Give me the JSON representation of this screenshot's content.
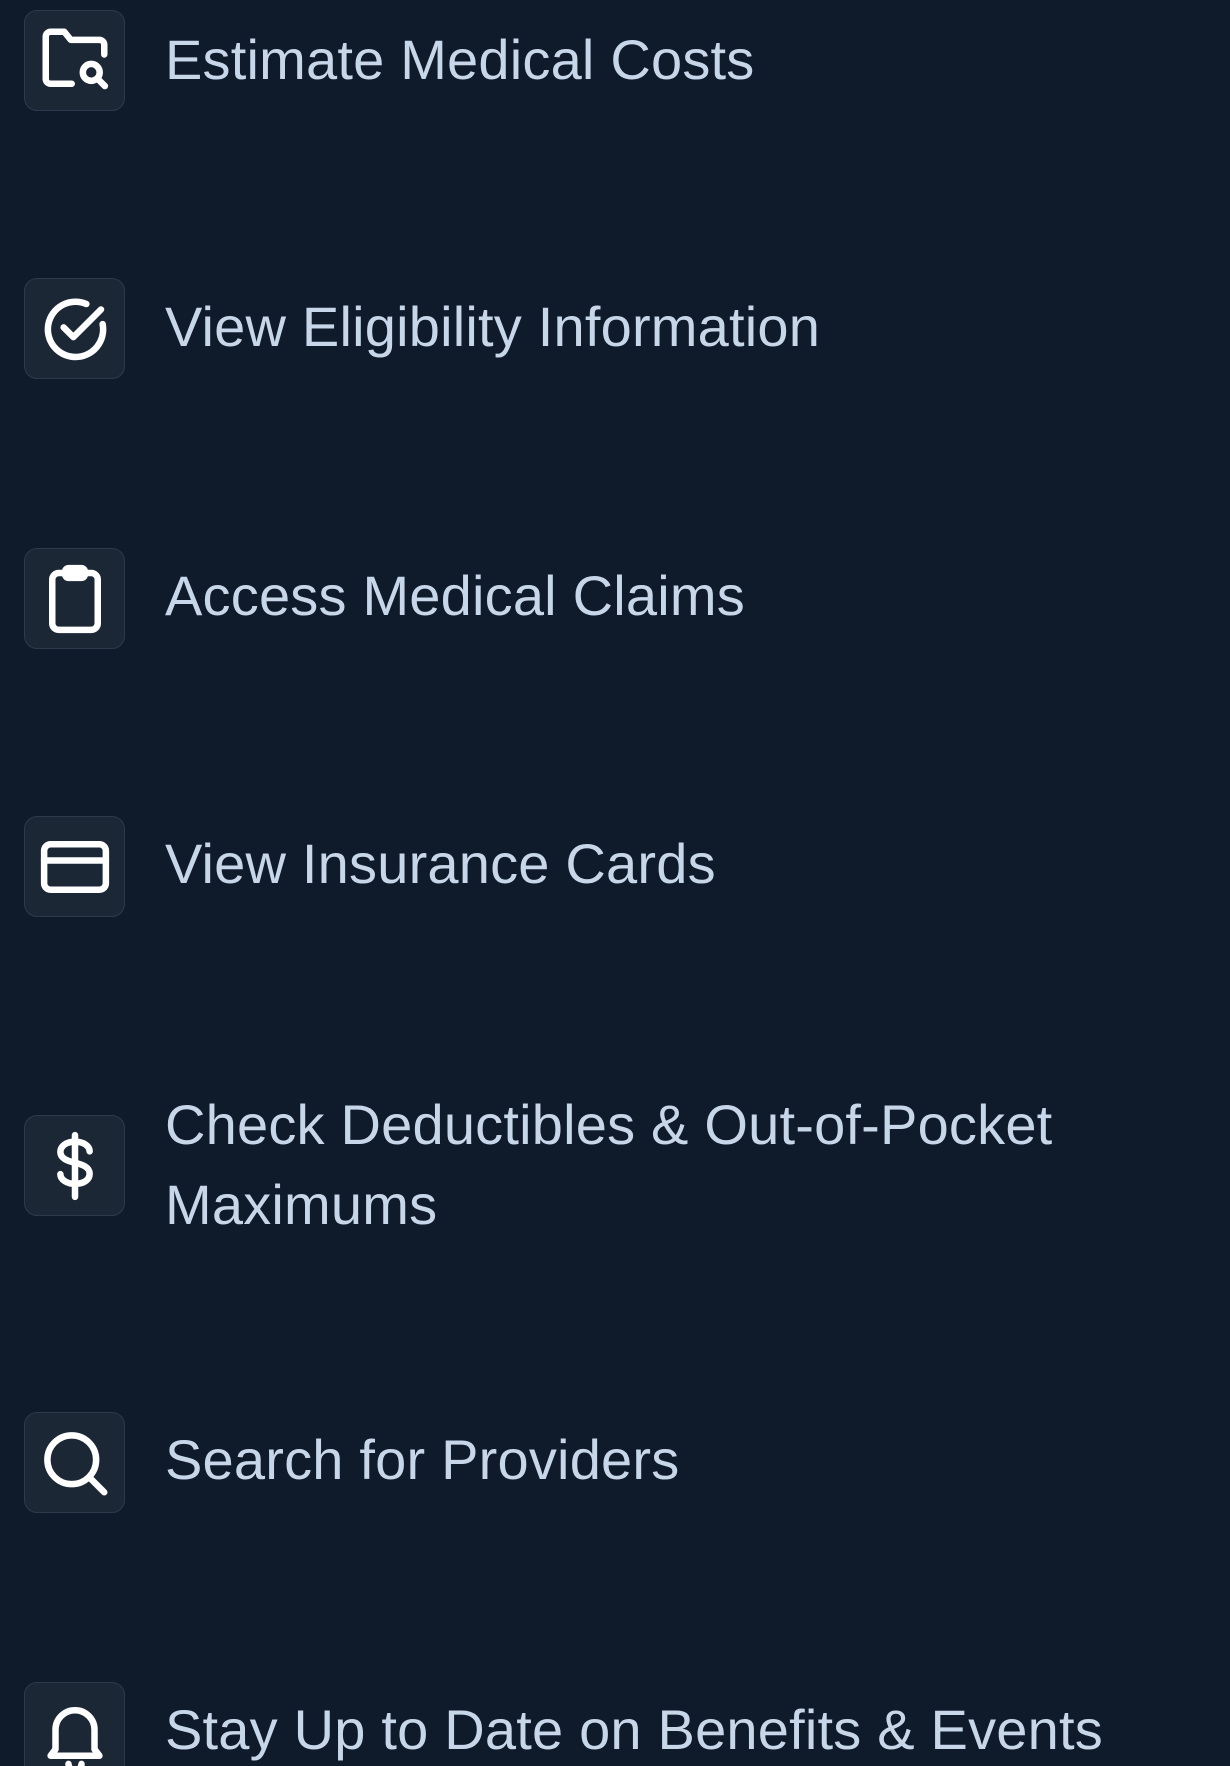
{
  "features": [
    {
      "icon": "folder-search-icon",
      "label": "Estimate Medical Costs"
    },
    {
      "icon": "check-circle-icon",
      "label": "View Eligibility Information"
    },
    {
      "icon": "clipboard-icon",
      "label": "Access Medical Claims"
    },
    {
      "icon": "credit-card-icon",
      "label": "View Insurance Cards"
    },
    {
      "icon": "dollar-icon",
      "label": "Check Deductibles & Out-of-Pocket Maximums"
    },
    {
      "icon": "search-icon",
      "label": "Search for Providers"
    },
    {
      "icon": "bell-icon",
      "label": "Stay Up to Date on Benefits & Events"
    }
  ],
  "colors": {
    "background": "#0f1a2a",
    "tile": "#1b2735",
    "text": "#c7d6e8",
    "icon_stroke": "#ffffff"
  }
}
